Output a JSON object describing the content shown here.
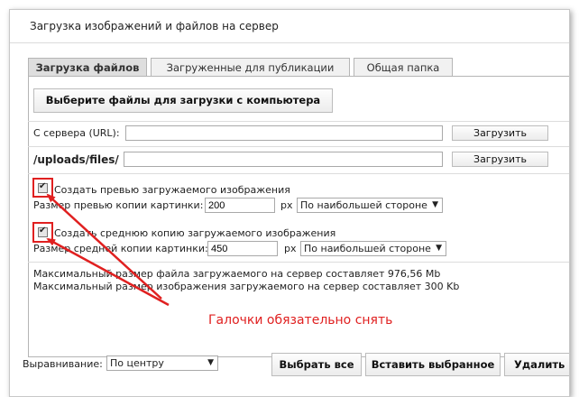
{
  "window": {
    "title": "Загрузка изображений и файлов на сервер"
  },
  "tabs": [
    {
      "label": "Загрузка файлов",
      "active": true
    },
    {
      "label": "Загруженные для публикации",
      "active": false
    },
    {
      "label": "Общая папка",
      "active": false
    }
  ],
  "upload": {
    "choose_label": "Выберите файлы для загрузки с компьютера",
    "server_url_label": "С сервера (URL):",
    "server_url_value": "",
    "server_url_button": "Загрузить",
    "path_label": "/uploads/files/",
    "path_value": "",
    "path_button": "Загрузить"
  },
  "preview": {
    "checkbox_label": "Создать превью загружаемого изображения",
    "checked": true,
    "size_label": "Размер превью копии картинки:",
    "size_value": "200",
    "unit": "px",
    "mode": "По наибольшей стороне"
  },
  "medium": {
    "checkbox_label": "Создать среднюю копию загружаемого изображения",
    "checked": true,
    "size_label": "Размер средней копии картинки:",
    "size_value": "450",
    "unit": "px",
    "mode": "По наибольшей стороне"
  },
  "limits": {
    "file_max": "Максимальный размер файла загружаемого на сервер составляет 976,56 Mb",
    "image_max": "Максимальный размер изображения загружаемого на сервер составляет 300 Kb"
  },
  "annotation": {
    "text": "Галочки обязательно снять",
    "color": "#e02020"
  },
  "footer": {
    "align_label": "Выравнивание:",
    "align_value": "По центру",
    "select_all": "Выбрать все",
    "insert_selected": "Вставить выбранное",
    "delete_selected": "Удалить в"
  }
}
